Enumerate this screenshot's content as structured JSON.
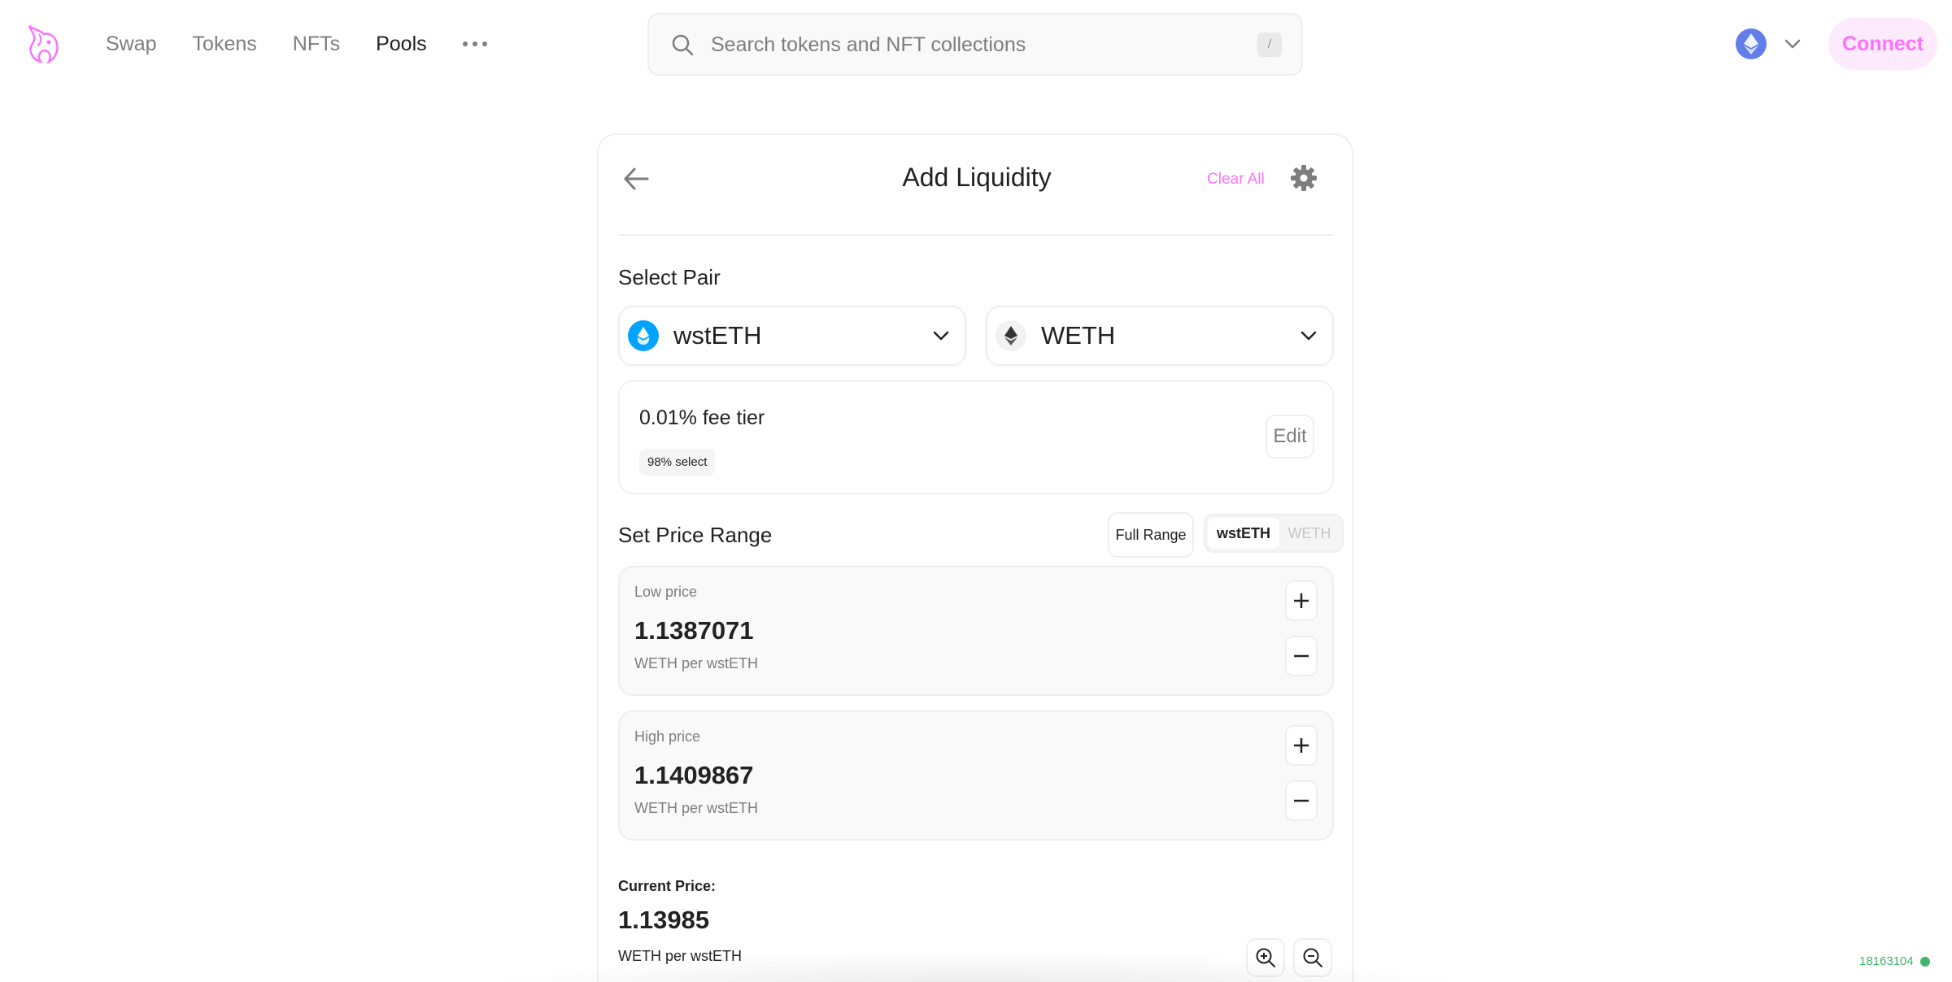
{
  "nav": {
    "links": [
      {
        "label": "Swap",
        "active": false
      },
      {
        "label": "Tokens",
        "active": false
      },
      {
        "label": "NFTs",
        "active": false
      },
      {
        "label": "Pools",
        "active": true
      }
    ],
    "more_icon": "ellipsis-icon"
  },
  "search": {
    "placeholder": "Search tokens and NFT collections",
    "shortcut": "/"
  },
  "chain": {
    "icon": "ethereum-icon"
  },
  "connect_label": "Connect",
  "card": {
    "title": "Add Liquidity",
    "clear_all": "Clear All",
    "select_pair_label": "Select Pair",
    "token_a": {
      "symbol": "wstETH",
      "icon": "wsteth-icon"
    },
    "token_b": {
      "symbol": "WETH",
      "icon": "weth-icon"
    },
    "fee": {
      "title": "0.01% fee tier",
      "badge": "98% select",
      "edit": "Edit"
    },
    "price_range": {
      "label": "Set Price Range",
      "full_range": "Full Range",
      "toggle": [
        "wstETH",
        "WETH"
      ],
      "low": {
        "label": "Low price",
        "value": "1.1387071",
        "unit": "WETH per wstETH"
      },
      "high": {
        "label": "High price",
        "value": "1.1409867",
        "unit": "WETH per wstETH"
      }
    },
    "current_price": {
      "label": "Current Price:",
      "value": "1.13985",
      "unit": "WETH per wstETH"
    }
  },
  "block_number": "18163104",
  "colors": {
    "accent": "#fc72ff",
    "accent_bg": "#fdeafc",
    "eth": "#627eea",
    "status_green": "#40b66b"
  }
}
